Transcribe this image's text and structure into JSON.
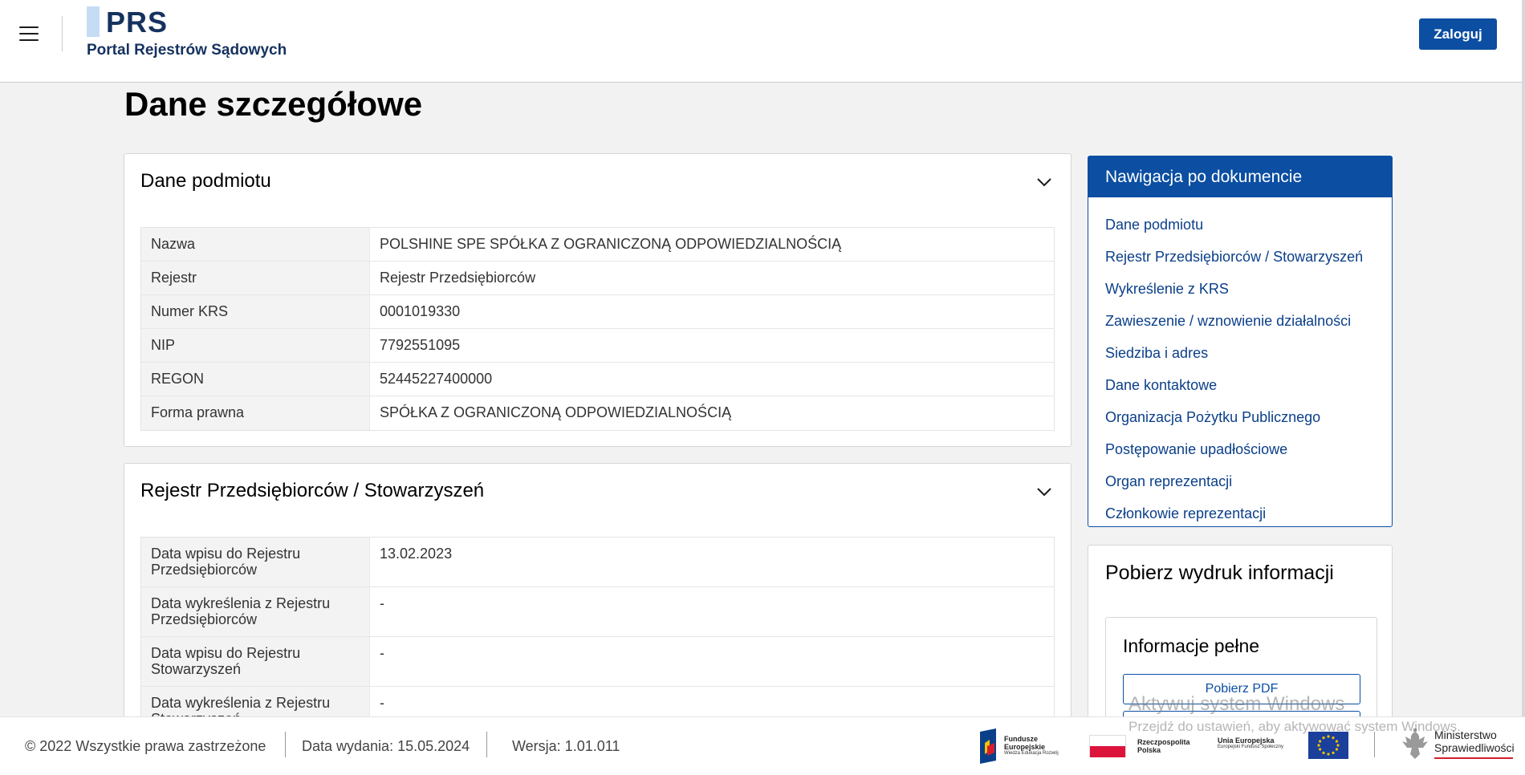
{
  "header": {
    "logo_title": "PRS",
    "logo_subtitle": "Portal Rejestrów Sądowych",
    "login_label": "Zaloguj"
  },
  "page": {
    "title": "Dane szczegółowe"
  },
  "section1": {
    "title": "Dane podmiotu",
    "rows": [
      {
        "label": "Nazwa",
        "value": "POLSHINE SPE SPÓŁKA Z OGRANICZONĄ ODPOWIEDZIALNOŚCIĄ"
      },
      {
        "label": "Rejestr",
        "value": "Rejestr Przedsiębiorców"
      },
      {
        "label": "Numer KRS",
        "value": "0001019330"
      },
      {
        "label": "NIP",
        "value": "7792551095"
      },
      {
        "label": "REGON",
        "value": "52445227400000"
      },
      {
        "label": "Forma prawna",
        "value": "SPÓŁKA Z OGRANICZONĄ ODPOWIEDZIALNOŚCIĄ"
      }
    ]
  },
  "section2": {
    "title": "Rejestr Przedsiębiorców / Stowarzyszeń",
    "rows": [
      {
        "label": "Data wpisu do Rejestru Przedsiębiorców",
        "value": "13.02.2023"
      },
      {
        "label": "Data wykreślenia z Rejestru Przedsiębiorców",
        "value": "-"
      },
      {
        "label": "Data wpisu do Rejestru Stowarzyszeń",
        "value": "-"
      },
      {
        "label": "Data wykreślenia z Rejestru Stowarzyszeń",
        "value": "-"
      }
    ]
  },
  "nav": {
    "title": "Nawigacja po dokumencie",
    "items": [
      "Dane podmiotu",
      "Rejestr Przedsiębiorców / Stowarzyszeń",
      "Wykreślenie z KRS",
      "Zawieszenie / wznowienie działalności",
      "Siedziba i adres",
      "Dane kontaktowe",
      "Organizacja Pożytku Publicznego",
      "Postępowanie upadłościowe",
      "Organ reprezentacji",
      "Członkowie reprezentacji"
    ]
  },
  "print": {
    "title": "Pobierz wydruk informacji",
    "inner_title": "Informacje pełne",
    "pdf_label": "Pobierz PDF"
  },
  "footer": {
    "copyright": "© 2022 Wszystkie prawa zastrzeżone",
    "release": "Data wydania: 15.05.2024",
    "version": "Wersja: 1.01.011",
    "fe_line1": "Fundusze",
    "fe_line2": "Europejskie",
    "fe_line3": "Wiedza Edukacja Rozwój",
    "rp_line1": "Rzeczpospolita",
    "rp_line2": "Polska",
    "ue_line1": "Unia Europejska",
    "ue_line2": "Europejski Fundusz Społeczny",
    "ms_line1": "Ministerstwo",
    "ms_line2": "Sprawiedliwości"
  },
  "watermark": {
    "line1": "Aktywuj system Windows",
    "line2": "Przejdź do ustawień, aby aktywować system Windows."
  },
  "colors": {
    "primary": "#0b4ea2",
    "brand_dark": "#15325f",
    "logo_accent": "#c5dcf5"
  }
}
